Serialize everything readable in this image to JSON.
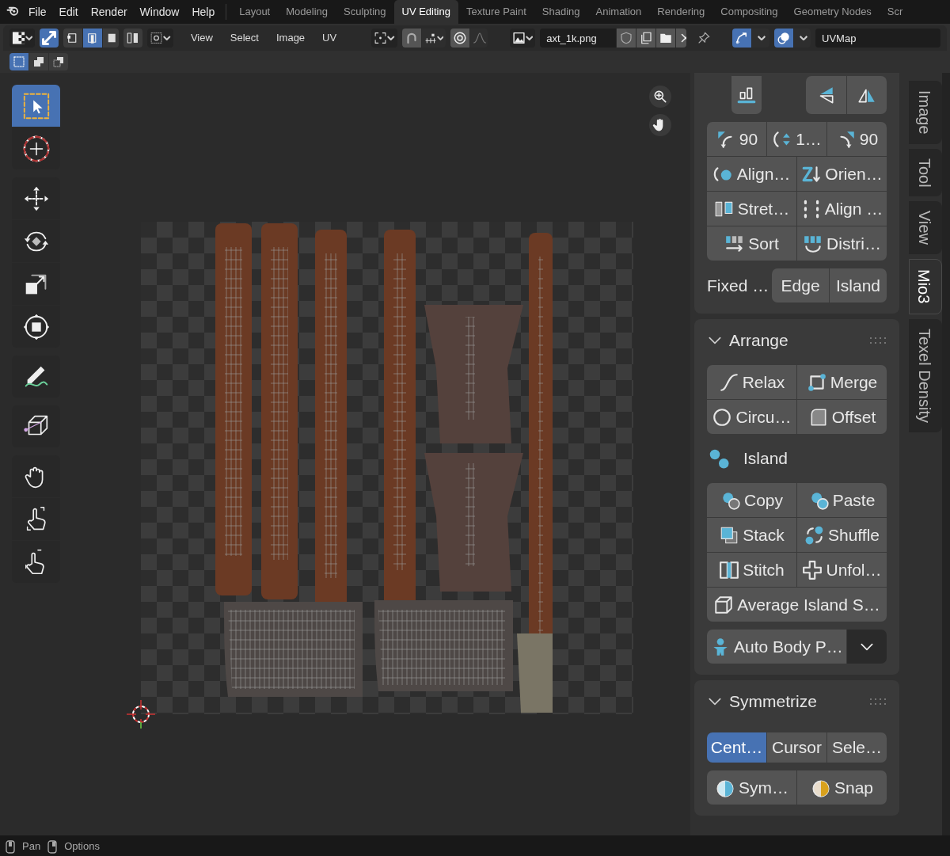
{
  "menu_bar": [
    "File",
    "Edit",
    "Render",
    "Window",
    "Help"
  ],
  "workspaces": [
    {
      "label": "Layout",
      "selected": false
    },
    {
      "label": "Modeling",
      "selected": false
    },
    {
      "label": "Sculpting",
      "selected": false
    },
    {
      "label": "UV Editing",
      "selected": true
    },
    {
      "label": "Texture Paint",
      "selected": false
    },
    {
      "label": "Shading",
      "selected": false
    },
    {
      "label": "Animation",
      "selected": false
    },
    {
      "label": "Rendering",
      "selected": false
    },
    {
      "label": "Compositing",
      "selected": false
    },
    {
      "label": "Geometry Nodes",
      "selected": false
    },
    {
      "label": "Scr",
      "selected": false
    }
  ],
  "header": {
    "uv_sync": {
      "on": true
    },
    "select_modes": [
      {
        "kind": "vertex",
        "selected": false
      },
      {
        "kind": "edge",
        "selected": true
      },
      {
        "kind": "face",
        "selected": false
      }
    ],
    "menus": [
      "View",
      "Select",
      "Image",
      "UV"
    ],
    "image_name": "axt_1k.png",
    "gizmos": {
      "on": true
    },
    "overlays": {
      "on": true
    },
    "uv_map": "UVMap",
    "box_modes": [
      {
        "kind": "new",
        "selected": true
      },
      {
        "kind": "extend",
        "selected": false
      },
      {
        "kind": "subtract",
        "selected": false
      }
    ]
  },
  "tools": [
    {
      "kind": "select",
      "selected": true
    },
    {
      "kind": "cursor",
      "selected": false
    },
    {
      "kind": "move",
      "selected": false
    },
    {
      "kind": "rotate",
      "selected": false
    },
    {
      "kind": "scale",
      "selected": false
    },
    {
      "kind": "transform",
      "selected": false
    },
    {
      "kind": "annotate",
      "selected": false
    },
    {
      "kind": "cube",
      "selected": false
    },
    {
      "kind": "grab",
      "selected": false
    },
    {
      "kind": "pinch",
      "selected": false
    },
    {
      "kind": "relax",
      "selected": false
    }
  ],
  "sidebar": {
    "tabs": [
      {
        "label": "Image",
        "selected": false
      },
      {
        "label": "Tool",
        "selected": false
      },
      {
        "label": "View",
        "selected": false
      },
      {
        "label": "Mio3",
        "selected": true
      },
      {
        "label": "Texel Density",
        "selected": false
      }
    ],
    "align_rows": [
      [
        {
          "kind": "rotate-left",
          "label": "90"
        },
        {
          "kind": "flip-arrows",
          "label": "1…"
        },
        {
          "kind": "rotate-right",
          "label": "90"
        }
      ],
      [
        {
          "kind": "align-island",
          "label": "Align…"
        },
        {
          "kind": "orient",
          "label": "Orien…"
        }
      ],
      [
        {
          "kind": "stretch",
          "label": "Stret…"
        },
        {
          "kind": "dots",
          "label": "Align …"
        }
      ],
      [
        {
          "kind": "sort",
          "label": "Sort"
        },
        {
          "kind": "distribute",
          "label": "Distri…"
        }
      ]
    ],
    "fixed_label": "Fixed …",
    "fixed_options": [
      {
        "label": "Edge",
        "selected": false
      },
      {
        "label": "Island",
        "selected": false
      }
    ],
    "arrange": {
      "title": "Arrange",
      "expanded": true,
      "rows": [
        [
          {
            "kind": "curve",
            "label": "Relax"
          },
          {
            "kind": "merge",
            "label": "Merge"
          }
        ],
        [
          {
            "kind": "circle",
            "label": "Circu…"
          },
          {
            "kind": "offset",
            "label": "Offset"
          }
        ]
      ],
      "island_label": "Island",
      "island_rows": [
        [
          {
            "kind": "copy",
            "label": "Copy"
          },
          {
            "kind": "paste",
            "label": "Paste"
          }
        ],
        [
          {
            "kind": "stack",
            "label": "Stack"
          },
          {
            "kind": "shuffle",
            "label": "Shuffle"
          }
        ],
        [
          {
            "kind": "stitch",
            "label": "Stitch"
          },
          {
            "kind": "unfold",
            "label": "Unfol…"
          }
        ],
        [
          {
            "kind": "cube",
            "label": "Average Island S…"
          }
        ]
      ],
      "auto_body": "Auto Body P…"
    },
    "symmetrize": {
      "title": "Symmetrize",
      "expanded": true,
      "pivot_options": [
        {
          "label": "Cent…",
          "selected": true
        },
        {
          "label": "Cursor",
          "selected": false
        },
        {
          "label": "Sele…",
          "selected": false
        }
      ],
      "rows": [
        [
          {
            "kind": "sym",
            "label": "Sym…"
          },
          {
            "kind": "snap",
            "label": "Snap"
          }
        ]
      ]
    }
  },
  "status_bar": [
    "Pan",
    "Options"
  ]
}
